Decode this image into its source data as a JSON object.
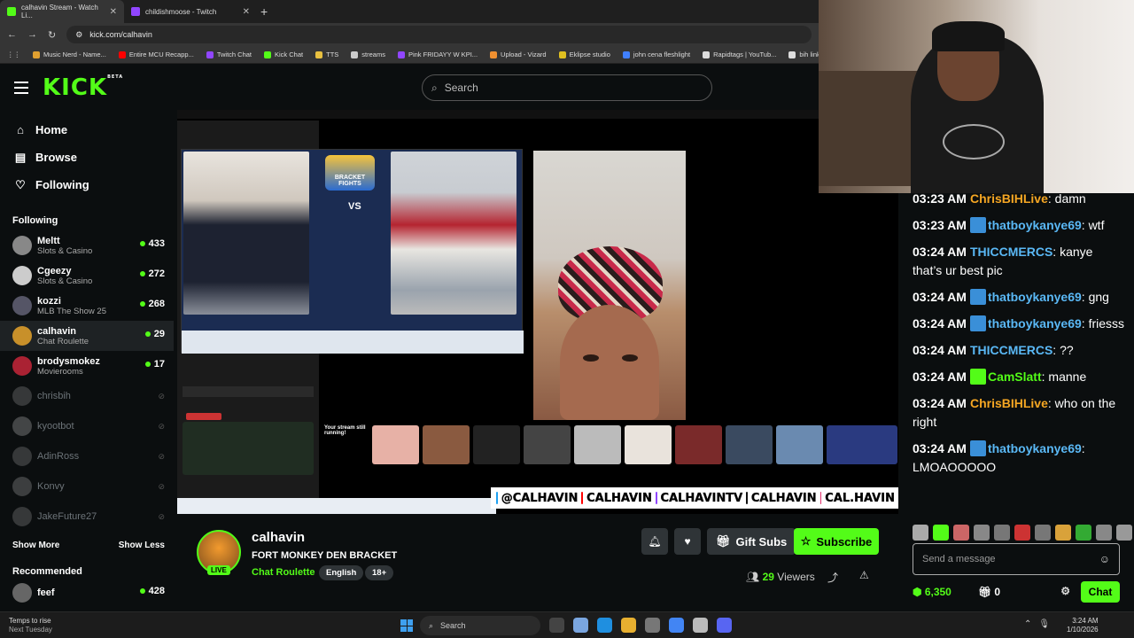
{
  "browser": {
    "tabs": [
      {
        "title": "calhavin Stream - Watch Li...",
        "color": "#53fc18",
        "active": true
      },
      {
        "title": "childishmoose - Twitch",
        "color": "#9146ff",
        "active": false
      }
    ],
    "url": "kick.com/calhavin",
    "bookmarks": [
      {
        "label": "Music Nerd - Name...",
        "color": "#e0a030"
      },
      {
        "label": "Entire MCU Recapp...",
        "color": "#ff0000"
      },
      {
        "label": "Twitch Chat",
        "color": "#9146ff"
      },
      {
        "label": "Kick Chat",
        "color": "#53fc18"
      },
      {
        "label": "TTS",
        "color": "#e8c040"
      },
      {
        "label": "streams",
        "color": "#cccccc"
      },
      {
        "label": "Pink FRIDAYY W KPI...",
        "color": "#9146ff"
      },
      {
        "label": "Upload - Vizard",
        "color": "#f09030"
      },
      {
        "label": "Eklipse studio",
        "color": "#e0c020"
      },
      {
        "label": "john cena fleshlight",
        "color": "#4080ff"
      },
      {
        "label": "Rapidtags | YouTub...",
        "color": "#dddddd"
      },
      {
        "label": "bih links",
        "color": "#dddddd"
      }
    ]
  },
  "kick": {
    "logo": "KICK",
    "logo_beta": "BETA",
    "search_placeholder": "Search",
    "accent": "#53fc18"
  },
  "sidebar": {
    "nav": [
      {
        "label": "Home",
        "icon": "home-icon",
        "glyph": "⌂"
      },
      {
        "label": "Browse",
        "icon": "browse-icon",
        "glyph": "▤"
      },
      {
        "label": "Following",
        "icon": "heart-icon",
        "glyph": "♡"
      }
    ],
    "following_label": "Following",
    "channels": [
      {
        "name": "Meltt",
        "category": "Slots & Casino",
        "viewers": "433",
        "live": true,
        "color": "#888"
      },
      {
        "name": "Cgeezy",
        "category": "Slots & Casino",
        "viewers": "272",
        "live": true,
        "color": "#ccc"
      },
      {
        "name": "kozzi",
        "category": "MLB The Show 25",
        "viewers": "268",
        "live": true,
        "color": "#556"
      },
      {
        "name": "calhavin",
        "category": "Chat Roulette",
        "viewers": "29",
        "live": true,
        "color": "#c8902a"
      },
      {
        "name": "brodysmokez",
        "category": "Movierooms",
        "viewers": "17",
        "live": true,
        "color": "#a23"
      },
      {
        "name": "chrisbih",
        "category": "",
        "viewers": "",
        "live": false,
        "color": "#777"
      },
      {
        "name": "kyootbot",
        "category": "",
        "viewers": "",
        "live": false,
        "color": "#999"
      },
      {
        "name": "AdinRoss",
        "category": "",
        "viewers": "",
        "live": false,
        "color": "#777"
      },
      {
        "name": "Konvy",
        "category": "",
        "viewers": "",
        "live": false,
        "color": "#888"
      },
      {
        "name": "JakeFuture27",
        "category": "",
        "viewers": "",
        "live": false,
        "color": "#777"
      }
    ],
    "show_more": "Show More",
    "show_less": "Show Less",
    "recommended_label": "Recommended",
    "recommended": [
      {
        "name": "feef",
        "viewers": "428"
      }
    ]
  },
  "video": {
    "bracket_vs": "VS",
    "bracket_logo": "BRACKET FIGHTS",
    "notif_text": "Your stream still running!",
    "social_handles": [
      "@CALHAVIN",
      "CALHAVIN",
      "CALHAVINTV",
      "CALHAVIN",
      "CAL.HAVIN"
    ]
  },
  "stream": {
    "channel": "calhavin",
    "title": "FORT MONKEY DEN BRACKET",
    "category": "Chat Roulette",
    "tags": [
      "English",
      "18+"
    ],
    "live_label": "LIVE",
    "gift_label": "Gift Subs",
    "subscribe_label": "Subscribe",
    "viewers_count": "29",
    "viewers_label": "Viewers"
  },
  "chat": {
    "messages": [
      {
        "time": "03:23 AM",
        "user": "ChrisBIHLive",
        "color": "#f5a623",
        "badge": "",
        "text": "damn"
      },
      {
        "time": "03:23 AM",
        "user": "thatboykanye69",
        "color": "#5ab8f5",
        "badge": "#3a8fd8",
        "text": "wtf"
      },
      {
        "time": "03:24 AM",
        "user": "THICCMERCS",
        "color": "#5ab8f5",
        "badge": "",
        "text": "kanye that’s ur best pic"
      },
      {
        "time": "03:24 AM",
        "user": "thatboykanye69",
        "color": "#5ab8f5",
        "badge": "#3a8fd8",
        "text": "gng"
      },
      {
        "time": "03:24 AM",
        "user": "thatboykanye69",
        "color": "#5ab8f5",
        "badge": "#3a8fd8",
        "text": "friesss"
      },
      {
        "time": "03:24 AM",
        "user": "THICCMERCS",
        "color": "#5ab8f5",
        "badge": "",
        "text": "??"
      },
      {
        "time": "03:24 AM",
        "user": "CamSlatt",
        "color": "#53fc18",
        "badge": "#53fc18",
        "text": "manne"
      },
      {
        "time": "03:24 AM",
        "user": "ChrisBIHLive",
        "color": "#f5a623",
        "badge": "",
        "text": "who on the right"
      },
      {
        "time": "03:24 AM",
        "user": "thatboykanye69",
        "color": "#5ab8f5",
        "badge": "#3a8fd8",
        "text": "LMOAOOOOO"
      }
    ],
    "input_placeholder": "Send a message",
    "points": "6,350",
    "gift_count": "0",
    "chat_button": "Chat"
  },
  "taskbar": {
    "weather_line1": "Temps to rise",
    "weather_line2": "Next Tuesday",
    "search": "Search",
    "time": "3:24 AM",
    "date": "1/10/2026"
  }
}
